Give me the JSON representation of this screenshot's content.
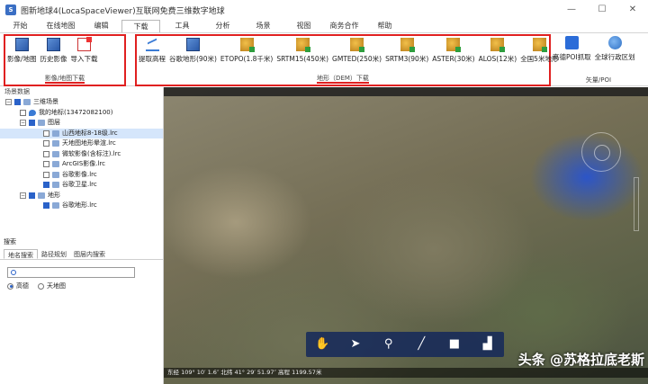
{
  "window": {
    "title": "图新地球4(LocaSpaceViewer)互联网免费三维数字地球",
    "minimize": "—",
    "maximize": "☐",
    "close": "✕"
  },
  "menu": [
    "开始",
    "在线地图",
    "编辑",
    "下载",
    "工具",
    "分析",
    "场景",
    "视图",
    "商务合作",
    "帮助"
  ],
  "ribbon": {
    "group1": {
      "label": "影像/地图下载",
      "buttons": [
        "影像/地图",
        "历史影像",
        "导入下载"
      ]
    },
    "group2": {
      "label": "地形（DEM）下载",
      "buttons": [
        "提取高程",
        "谷歌地形(90米)",
        "ETOPO(1.8千米)",
        "SRTM15(450米)",
        "GMTED(250米)",
        "SRTM3(90米)",
        "ASTER(30米)",
        "ALOS(12米)",
        "全国5米地形"
      ]
    },
    "group3": {
      "label": "矢量/POI",
      "buttons": [
        "高德POI抓取",
        "全球行政区划"
      ]
    }
  },
  "sidebar": {
    "header": "场景数据",
    "tree": [
      {
        "label": "三维场景"
      },
      {
        "label": "我的地标(13472082100)"
      },
      {
        "label": "图层"
      },
      {
        "label": "山西地标8-18级.lrc"
      },
      {
        "label": "天地图地形晕渲.lrc"
      },
      {
        "label": "微软影像(含标注).lrc"
      },
      {
        "label": "ArcGIS影像.lrc"
      },
      {
        "label": "谷歌影像.lrc"
      },
      {
        "label": "谷歌卫星.lrc"
      },
      {
        "label": "地形"
      },
      {
        "label": "谷歌地形.lrc"
      }
    ]
  },
  "search": {
    "title": "搜索",
    "tabs": [
      "地名搜索",
      "路径规划",
      "图层内搜索"
    ],
    "placeholder": "",
    "radios": [
      "高德",
      "天地图"
    ]
  },
  "map": {
    "status": "东经 109° 10′ 1.6″  北纬 41° 29′ 51.97″  高程 1199.57米",
    "watermark": "头条 @苏格拉底老斯",
    "tools": [
      "✋",
      "➤",
      "⚲",
      "╱",
      "■",
      "▟"
    ]
  }
}
